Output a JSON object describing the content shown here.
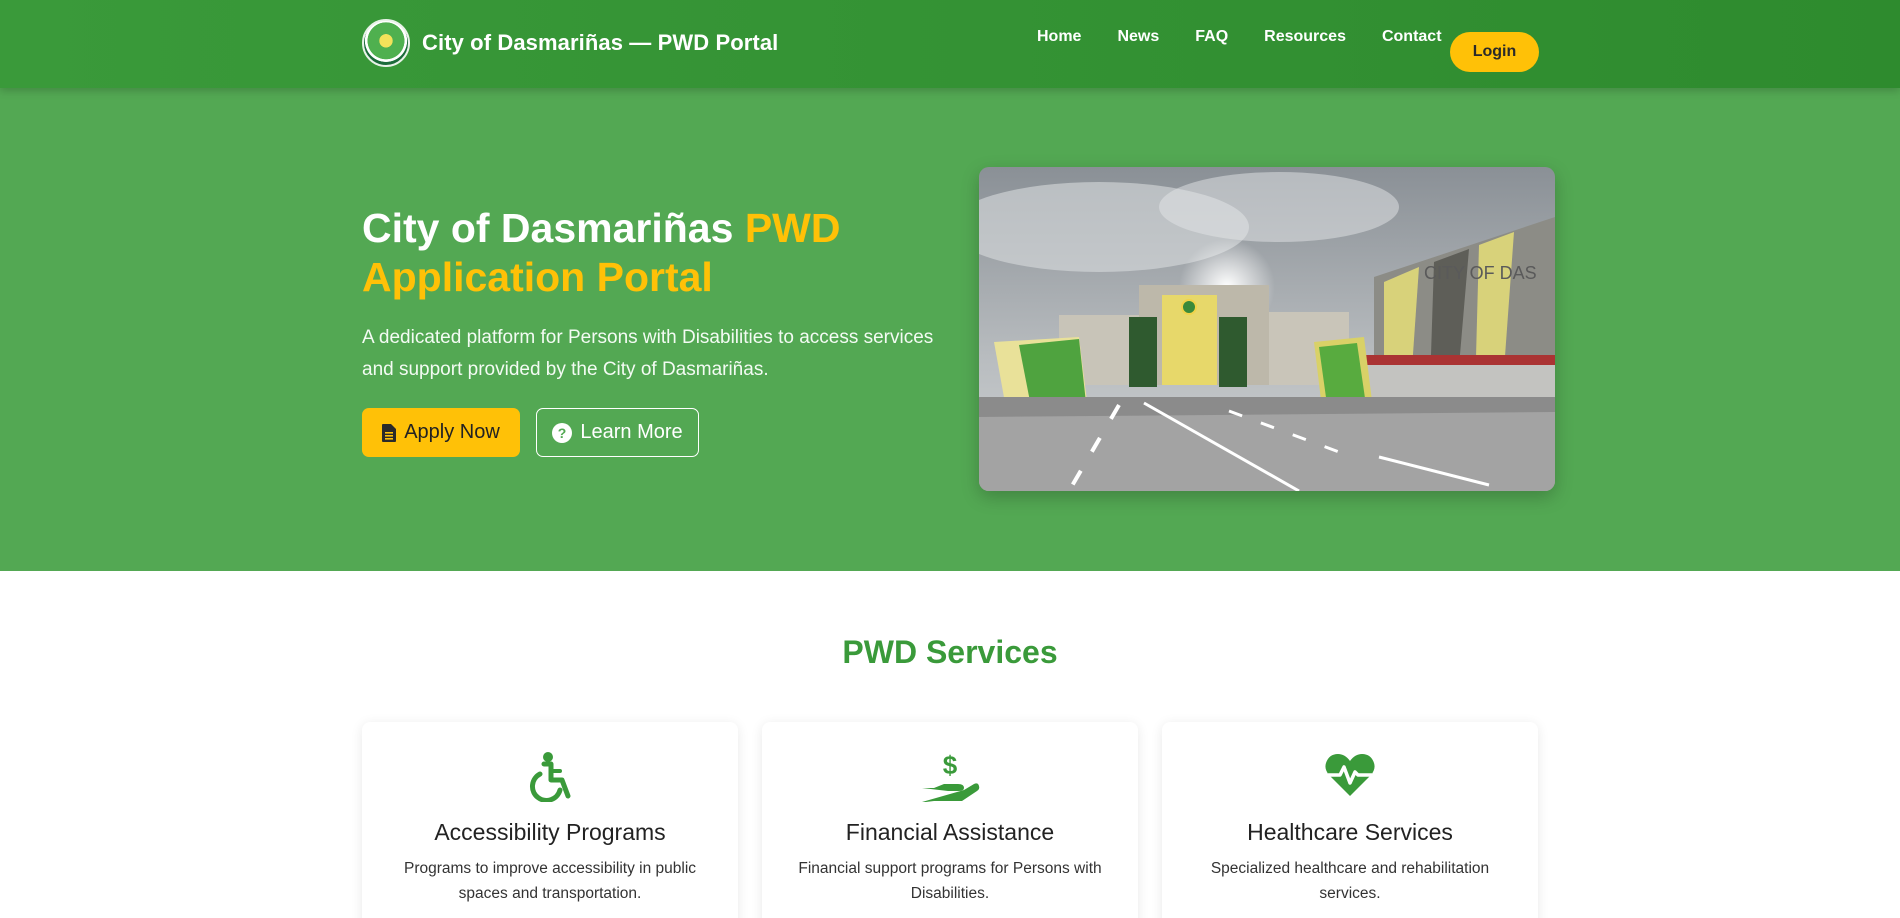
{
  "navbar": {
    "brand": "City of Dasmariñas — PWD Portal",
    "links": [
      "Home",
      "News",
      "FAQ",
      "Resources",
      "Contact"
    ],
    "login_label": "Login"
  },
  "hero": {
    "title_part1": "City of Dasmariñas",
    "title_part2": "PWD Application Portal",
    "description": "A dedicated platform for Persons with Disabilities to access services and support provided by the City of Dasmariñas.",
    "apply_label": "Apply Now",
    "learn_label": "Learn More",
    "image_sign_text": "CITY OF DAS"
  },
  "services": {
    "title": "PWD Services",
    "cards": [
      {
        "icon": "wheelchair-icon",
        "title": "Accessibility Programs",
        "description": "Programs to improve accessibility in public spaces and transportation."
      },
      {
        "icon": "hand-holding-dollar-icon",
        "title": "Financial Assistance",
        "description": "Financial support programs for Persons with Disabilities."
      },
      {
        "icon": "heart-pulse-icon",
        "title": "Healthcare Services",
        "description": "Specialized healthcare and rehabilitation services."
      }
    ]
  },
  "colors": {
    "nav_green": "#3a9a3a",
    "hero_green": "#53a853",
    "accent_yellow": "#ffc107",
    "heading_green": "#3a9a3a"
  }
}
